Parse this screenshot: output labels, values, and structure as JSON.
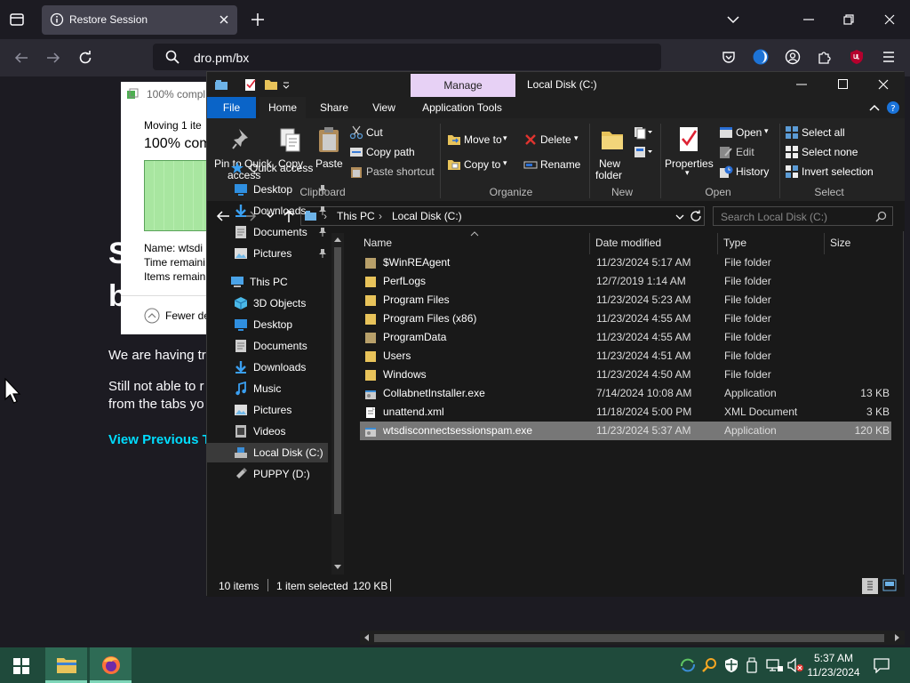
{
  "browser": {
    "tab_title": "Restore Session",
    "url": "dro.pm/bx",
    "page": {
      "heading_frag1": "S",
      "heading_frag2": "b",
      "line1": "We are having tr",
      "line2a": "Still not able to r",
      "line2b": "from the tabs yo",
      "link": "View Previous Ta"
    }
  },
  "copy_dialog": {
    "title": "100% compl",
    "moving": "Moving 1 ite",
    "percent": "100% com",
    "name": "Name:  wtsdi",
    "time": "Time remaini",
    "items": "Items remain",
    "fewer": "Fewer de"
  },
  "explorer": {
    "manage_tab": "Manage",
    "title": "Local Disk (C:)",
    "ribbon_tabs": [
      "File",
      "Home",
      "Share",
      "View",
      "Application Tools"
    ],
    "clipboard": {
      "pin": "Pin to Quick",
      "pin2": "access",
      "copy": "Copy",
      "paste": "Paste",
      "cut": "Cut",
      "copy_path": "Copy path",
      "paste_shortcut": "Paste shortcut",
      "label": "Clipboard"
    },
    "organize": {
      "move_to": "Move to",
      "copy_to": "Copy to",
      "delete": "Delete",
      "rename": "Rename",
      "label": "Organize"
    },
    "new": {
      "new_folder": "New",
      "new_folder2": "folder",
      "label": "New"
    },
    "open": {
      "properties": "Properties",
      "open": "Open",
      "edit": "Edit",
      "history": "History",
      "label": "Open"
    },
    "select": {
      "select_all": "Select all",
      "select_none": "Select none",
      "invert": "Invert selection",
      "label": "Select"
    },
    "address": {
      "crumb1": "This PC",
      "crumb2": "Local Disk (C:)",
      "search_placeholder": "Search Local Disk (C:)"
    },
    "nav": [
      {
        "label": "Quick access",
        "icon": "star-icon",
        "color": "#3a9ff0",
        "indent": 0,
        "pinned": false
      },
      {
        "label": "Desktop",
        "icon": "desktop-icon",
        "color": "#2f8fe0",
        "indent": 1,
        "pinned": true
      },
      {
        "label": "Downloads",
        "icon": "download-icon",
        "color": "#3a9ff0",
        "indent": 1,
        "pinned": true
      },
      {
        "label": "Documents",
        "icon": "document-icon",
        "color": "#cfcfcf",
        "indent": 1,
        "pinned": true
      },
      {
        "label": "Pictures",
        "icon": "picture-icon",
        "color": "#6fb8e8",
        "indent": 1,
        "pinned": true
      },
      {
        "label": "This PC",
        "icon": "computer-icon",
        "color": "#4aa3e8",
        "indent": 0,
        "pinned": false
      },
      {
        "label": "3D Objects",
        "icon": "cube-icon",
        "color": "#4ab8e8",
        "indent": 1,
        "pinned": false
      },
      {
        "label": "Desktop",
        "icon": "desktop-icon",
        "color": "#2f8fe0",
        "indent": 1,
        "pinned": false
      },
      {
        "label": "Documents",
        "icon": "document-icon",
        "color": "#cfcfcf",
        "indent": 1,
        "pinned": false
      },
      {
        "label": "Downloads",
        "icon": "download-icon",
        "color": "#3a9ff0",
        "indent": 1,
        "pinned": false
      },
      {
        "label": "Music",
        "icon": "music-icon",
        "color": "#3a9ff0",
        "indent": 1,
        "pinned": false
      },
      {
        "label": "Pictures",
        "icon": "picture-icon",
        "color": "#6fb8e8",
        "indent": 1,
        "pinned": false
      },
      {
        "label": "Videos",
        "icon": "video-icon",
        "color": "#bbbbbb",
        "indent": 1,
        "pinned": false
      },
      {
        "label": "Local Disk (C:)",
        "icon": "drive-icon",
        "color": "#bbbbbb",
        "indent": 1,
        "pinned": false,
        "selected": true
      },
      {
        "label": "PUPPY (D:)",
        "icon": "usb-drive-icon",
        "color": "#bbbbbb",
        "indent": 1,
        "pinned": false
      }
    ],
    "columns": [
      "Name",
      "Date modified",
      "Type",
      "Size"
    ],
    "files": [
      {
        "name": "$WinREAgent",
        "date": "11/23/2024 5:17 AM",
        "type": "File folder",
        "size": "",
        "kind": "folder-dim"
      },
      {
        "name": "PerfLogs",
        "date": "12/7/2019 1:14 AM",
        "type": "File folder",
        "size": "",
        "kind": "folder"
      },
      {
        "name": "Program Files",
        "date": "11/23/2024 5:23 AM",
        "type": "File folder",
        "size": "",
        "kind": "folder"
      },
      {
        "name": "Program Files (x86)",
        "date": "11/23/2024 4:55 AM",
        "type": "File folder",
        "size": "",
        "kind": "folder"
      },
      {
        "name": "ProgramData",
        "date": "11/23/2024 4:55 AM",
        "type": "File folder",
        "size": "",
        "kind": "folder-dim"
      },
      {
        "name": "Users",
        "date": "11/23/2024 4:51 AM",
        "type": "File folder",
        "size": "",
        "kind": "folder"
      },
      {
        "name": "Windows",
        "date": "11/23/2024 4:50 AM",
        "type": "File folder",
        "size": "",
        "kind": "folder"
      },
      {
        "name": "CollabnetInstaller.exe",
        "date": "7/14/2024 10:08 AM",
        "type": "Application",
        "size": "13 KB",
        "kind": "exe"
      },
      {
        "name": "unattend.xml",
        "date": "11/18/2024 5:00 PM",
        "type": "XML Document",
        "size": "3 KB",
        "kind": "xml"
      },
      {
        "name": "wtsdisconnectsessionspam.exe",
        "date": "11/23/2024 5:37 AM",
        "type": "Application",
        "size": "120 KB",
        "kind": "exe",
        "selected": true
      }
    ],
    "status": {
      "count": "10 items",
      "selected": "1 item selected",
      "size": "120 KB"
    }
  },
  "taskbar": {
    "time": "5:37 AM",
    "date": "11/23/2024"
  },
  "colors": {
    "folder": "#e8c35a",
    "folder_dim": "#b8a06a",
    "accent": "#0a64c8",
    "link": "#00ddff",
    "taskbar": "#1f4a3b",
    "manage": "#e7d1f5"
  }
}
